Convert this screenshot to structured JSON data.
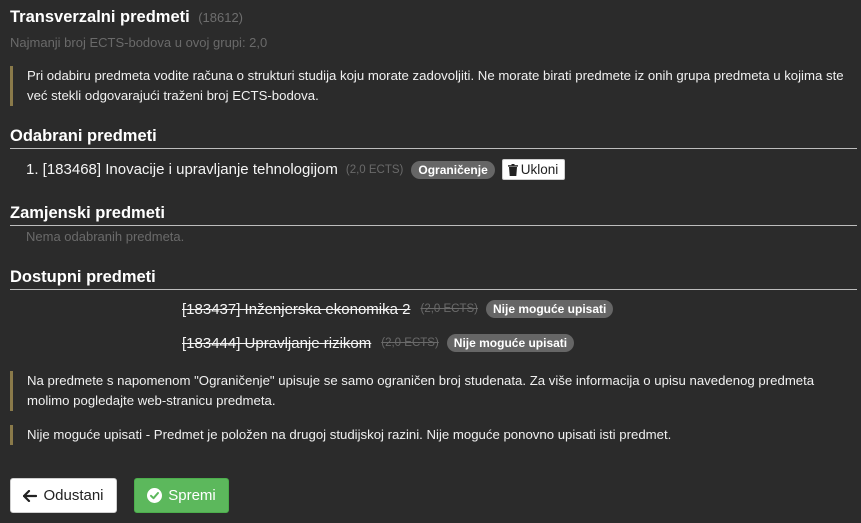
{
  "header": {
    "title": "Transverzalni predmeti",
    "group_id": "(18612)",
    "subtitle": "Najmanji broj ECTS-bodova u ovoj grupi: 2,0"
  },
  "notes": {
    "selection_info": "Pri odabiru predmeta vodite računa o strukturi studija koju morate zadovoljiti. Ne morate birati predmete iz onih grupa predmeta u kojima ste već stekli odgovarajući traženi broj ECTS-bodova.",
    "restriction_info": "Na predmete s napomenom \"Ograničenje\" upisuje se samo ograničen broj studenata. Za više informacija o upisu navedenog predmeta molimo pogledajte web-stranicu predmeta.",
    "cannot_enroll_info": "Nije moguće upisati - Predmet je položen na drugoj studijskoj razini. Nije moguće ponovno upisati isti predmet."
  },
  "selected": {
    "heading": "Odabrani predmeti",
    "items": [
      {
        "label": "1. [183468] Inovacije i upravljanje tehnologijom",
        "ects": "(2,0 ECTS)",
        "badge": "Ograničenje",
        "remove_label": "Ukloni"
      }
    ]
  },
  "replacement": {
    "heading": "Zamjenski predmeti",
    "empty": "Nema odabranih predmeta."
  },
  "available": {
    "heading": "Dostupni predmeti",
    "items": [
      {
        "label": "[183437] Inženjerska ekonomika 2",
        "ects": "(2,0 ECTS)",
        "badge": "Nije moguće upisati"
      },
      {
        "label": "[183444] Upravljanje rizikom",
        "ects": "(2,0 ECTS)",
        "badge": "Nije moguće upisati"
      }
    ]
  },
  "buttons": {
    "cancel": "Odustani",
    "save": "Spremi"
  },
  "colors": {
    "background": "#2b2b2b",
    "accent_green": "#5cb85c",
    "badge_gray": "#666666",
    "note_border": "#8a7a4a"
  },
  "icons": {
    "remove": "trash-icon",
    "cancel": "arrow-left-icon",
    "save": "check-circle-icon"
  }
}
